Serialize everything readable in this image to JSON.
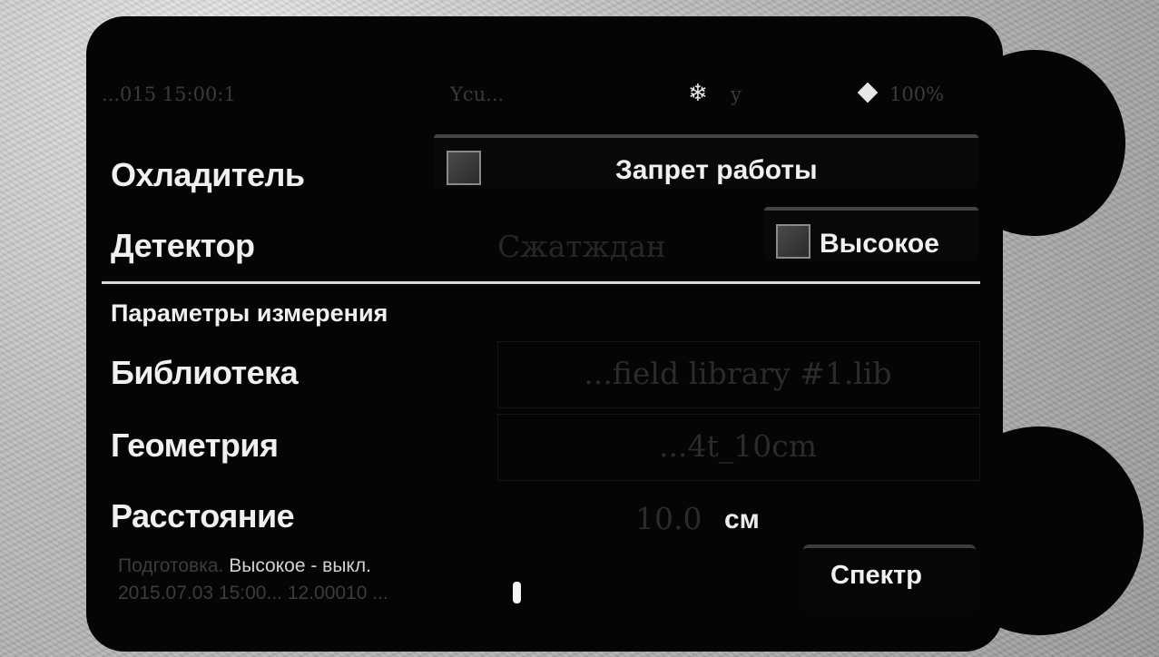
{
  "status_bar": {
    "time_text": "...015 15:00:1",
    "mode_text": "Ycu...",
    "snowflake_icon": "snowflake-icon",
    "cooler_value": "y",
    "battery_icon": "diamond-icon",
    "battery_text": "100%"
  },
  "cooler": {
    "label": "Охладитель",
    "option_label": "Запрет работы"
  },
  "detector": {
    "label": "Детектор",
    "state": "Сжатждан",
    "option_label": "Высокое"
  },
  "section_title": "Параметры измерения",
  "params": {
    "library_label": "Библиотека",
    "library_value": "...field library #1.lib",
    "geometry_label": "Геометрия",
    "geometry_value": "...4t_10cm",
    "distance_label": "Расстояние",
    "distance_value": "10.0",
    "distance_unit": "см"
  },
  "footer": {
    "line1_dim": "Подготовка.",
    "line1_bright": "Высокое - выкл.",
    "line2": "2015.07.03 15:00... 12.00010 ..."
  },
  "spectr_button": "Спектр"
}
